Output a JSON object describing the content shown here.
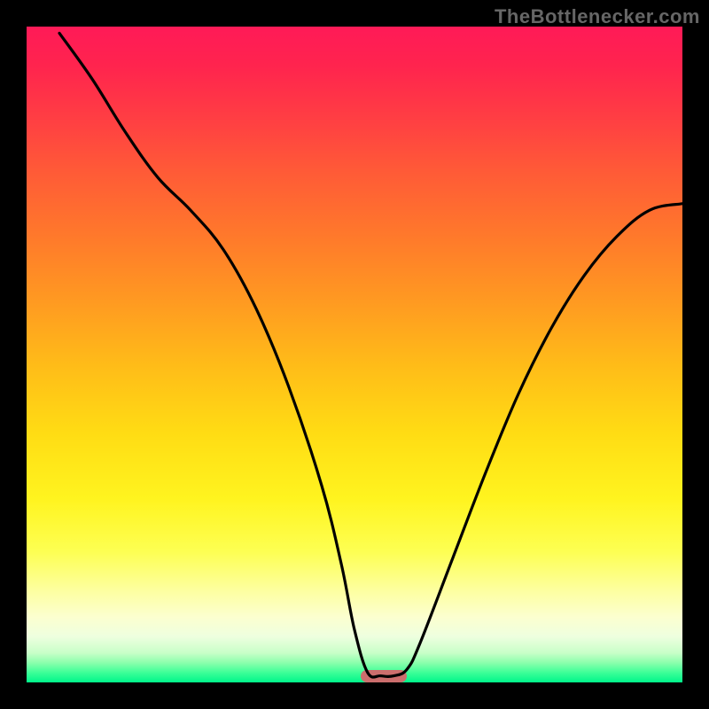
{
  "watermark": "TheBottlenecker.com",
  "chart_data": {
    "type": "line",
    "title": "",
    "xlabel": "",
    "ylabel": "",
    "xlim": [
      0,
      100
    ],
    "ylim": [
      0,
      100
    ],
    "x": [
      0,
      5,
      10,
      15,
      20,
      25,
      30,
      35,
      40,
      45,
      48,
      50,
      52,
      54,
      56,
      58,
      60,
      65,
      70,
      75,
      80,
      85,
      90,
      95,
      100
    ],
    "values": [
      null,
      99,
      92,
      84,
      77,
      72,
      66,
      57,
      45,
      30,
      18,
      8,
      1.5,
      1,
      1,
      2,
      6,
      19,
      32,
      44,
      54,
      62,
      68,
      72,
      73
    ],
    "marker": {
      "x_start": 51,
      "x_end": 58
    },
    "gradient_colors": {
      "top": "#ff1a57",
      "mid": "#ffdc14",
      "bottom": "#00f58a"
    }
  }
}
